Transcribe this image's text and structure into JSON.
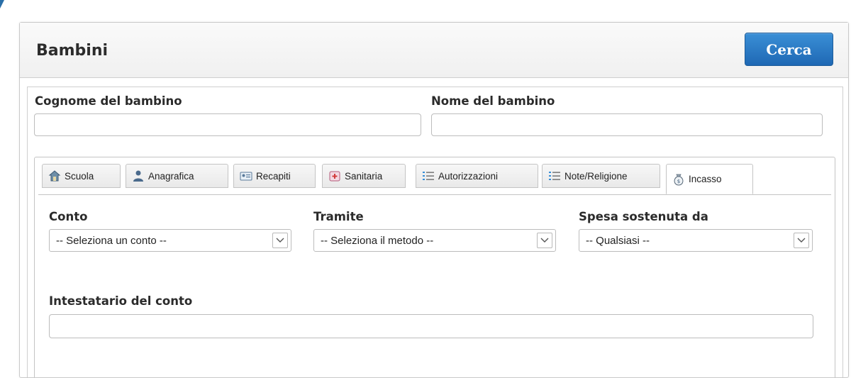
{
  "header": {
    "title": "Bambini",
    "search_label": "Cerca"
  },
  "fields": {
    "surname_label": "Cognome del bambino",
    "surname_value": "",
    "name_label": "Nome del bambino",
    "name_value": ""
  },
  "tabs": [
    {
      "label": "Scuola",
      "icon": "school-icon"
    },
    {
      "label": "Anagrafica",
      "icon": "person-icon"
    },
    {
      "label": "Recapiti",
      "icon": "contact-card-icon"
    },
    {
      "label": "Sanitaria",
      "icon": "medical-icon"
    },
    {
      "label": "Autorizzazioni",
      "icon": "list-icon"
    },
    {
      "label": "Note/Religione",
      "icon": "list-icon"
    },
    {
      "label": "Incasso",
      "icon": "money-bag-icon",
      "active": true
    }
  ],
  "incasso": {
    "account_label": "Conto",
    "account_selected": "-- Seleziona un conto --",
    "method_label": "Tramite",
    "method_selected": "-- Seleziona il metodo --",
    "expense_label": "Spesa sostenuta da",
    "expense_selected": "-- Qualsiasi --",
    "holder_label": "Intestatario del conto",
    "holder_value": ""
  },
  "colors": {
    "primary_button": "#2a77c4",
    "accent": "#2a6fa8"
  }
}
